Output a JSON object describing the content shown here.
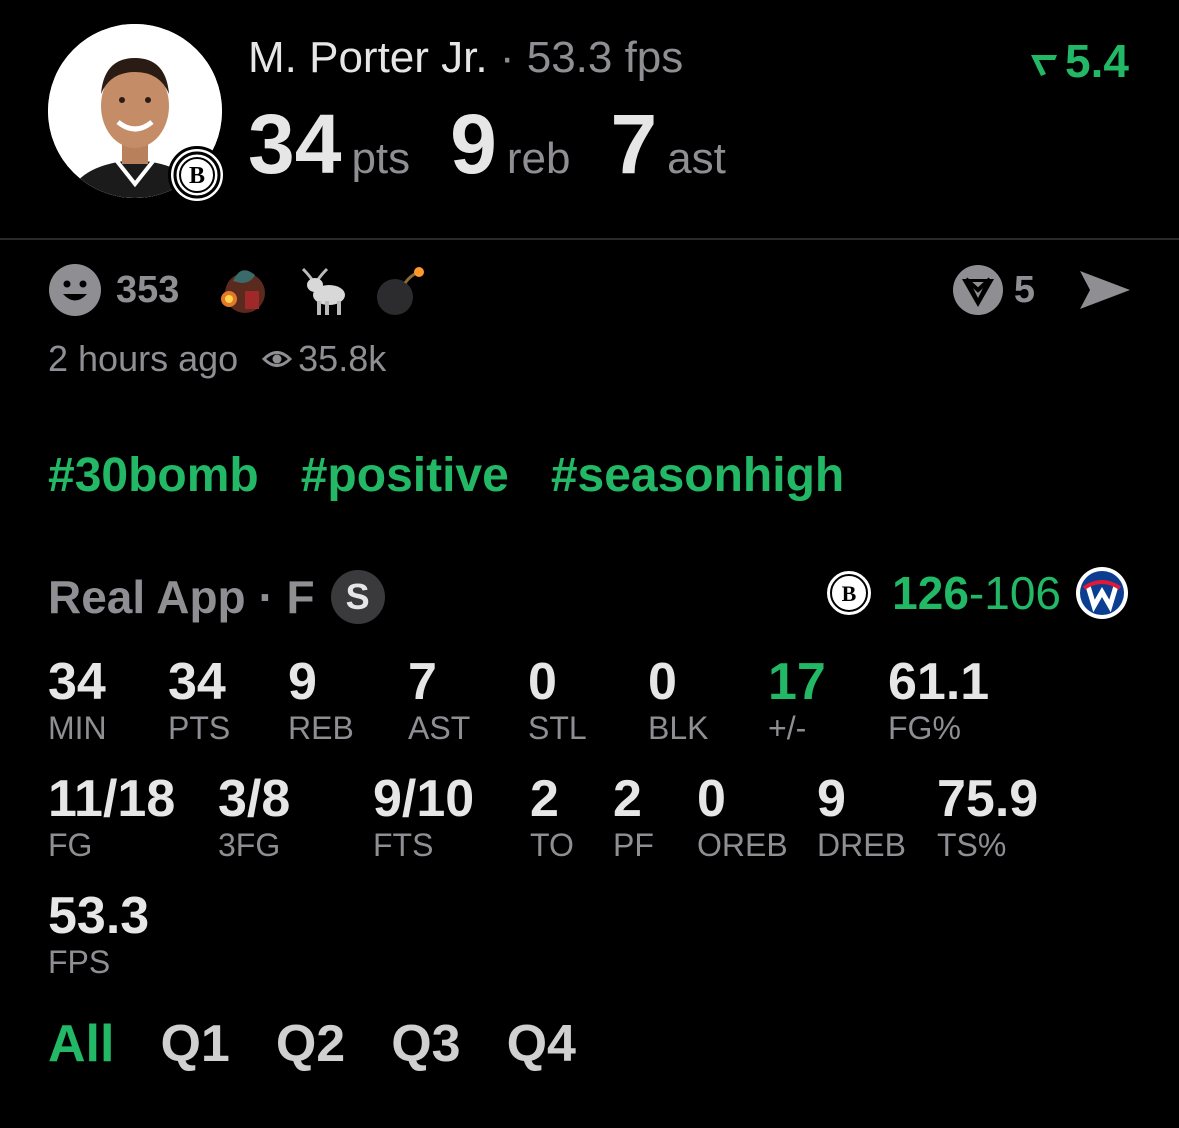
{
  "player": {
    "name": "M. Porter Jr.",
    "separator": "·",
    "fps_line": "53.3 fps",
    "trend_value": "5.4",
    "trend_icon": "fantasy-trend-icon",
    "avatar_icon": "player-avatar",
    "team_badge_icon": "nets-logo-icon",
    "team_badge_letter": "B"
  },
  "headline_stats": [
    {
      "value": "34",
      "label": "pts"
    },
    {
      "value": "9",
      "label": "reb"
    },
    {
      "value": "7",
      "label": "ast"
    }
  ],
  "reactions": {
    "count": "353",
    "icons": [
      "smile-icon",
      "fire-emoji-icon",
      "goat-emoji-icon",
      "bomb-emoji-icon"
    ],
    "comment_count": "5",
    "comment_icon": "comment-badge-icon",
    "share_icon": "send-icon"
  },
  "meta": {
    "time_ago": "2 hours ago",
    "views": "35.8k",
    "views_icon": "eye-icon"
  },
  "tags": [
    "#30bomb",
    "#positive",
    "#seasonhigh"
  ],
  "game": {
    "source": "Real App",
    "separator": "·",
    "status": "F",
    "badge": "S",
    "score_home": "126",
    "score_dash": "-",
    "score_away": "106",
    "home_logo": "nets-logo-icon",
    "away_logo": "wizards-logo-icon"
  },
  "stats_row1": [
    {
      "value": "34",
      "key": "MIN"
    },
    {
      "value": "34",
      "key": "PTS"
    },
    {
      "value": "9",
      "key": "REB"
    },
    {
      "value": "7",
      "key": "AST"
    },
    {
      "value": "0",
      "key": "STL"
    },
    {
      "value": "0",
      "key": "BLK"
    },
    {
      "value": "17",
      "key": "+/-"
    },
    {
      "value": "61.1",
      "key": "FG%"
    }
  ],
  "stats_row2": [
    {
      "value": "11/18",
      "key": "FG"
    },
    {
      "value": "3/8",
      "key": "3FG"
    },
    {
      "value": "9/10",
      "key": "FTS"
    },
    {
      "value": "2",
      "key": "TO"
    },
    {
      "value": "2",
      "key": "PF"
    },
    {
      "value": "0",
      "key": "OREB"
    },
    {
      "value": "9",
      "key": "DREB"
    },
    {
      "value": "75.9",
      "key": "TS%"
    }
  ],
  "stats_row3": [
    {
      "value": "53.3",
      "key": "FPS"
    }
  ],
  "periods": [
    "All",
    "Q1",
    "Q2",
    "Q3",
    "Q4"
  ],
  "colors": {
    "accent_green": "#22b866",
    "text_primary": "#e6e6e6",
    "text_secondary": "#8e8e93",
    "background": "#000000"
  }
}
